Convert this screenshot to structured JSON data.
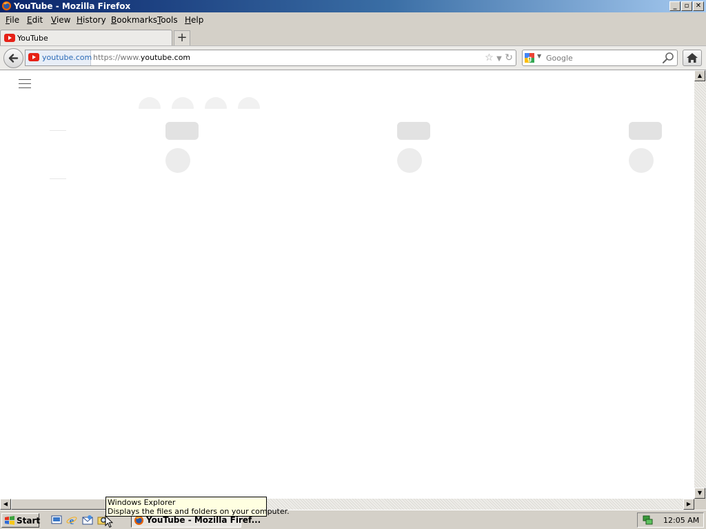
{
  "window": {
    "title": "YouTube - Mozilla Firefox"
  },
  "menu": {
    "items": [
      "File",
      "Edit",
      "View",
      "History",
      "Bookmarks",
      "Tools",
      "Help"
    ]
  },
  "tabs": [
    {
      "label": "YouTube"
    }
  ],
  "newtab": {
    "label": "+"
  },
  "navbar": {
    "identity_host": "youtube.com",
    "url_prefix": "https://www.",
    "url_host": "youtube.com",
    "search_placeholder": "Google"
  },
  "tooltip": {
    "title": "Windows Explorer",
    "description": "Displays the files and folders on your computer."
  },
  "taskbar": {
    "start_label": "Start",
    "task_label": "YouTube - Mozilla Firef...",
    "clock": "12:05 AM"
  },
  "colors": {
    "title_gradient_start": "#0a246a",
    "title_gradient_end": "#a6caf0",
    "youtube_red": "#e62117",
    "skeleton": "#e2e2e2"
  }
}
